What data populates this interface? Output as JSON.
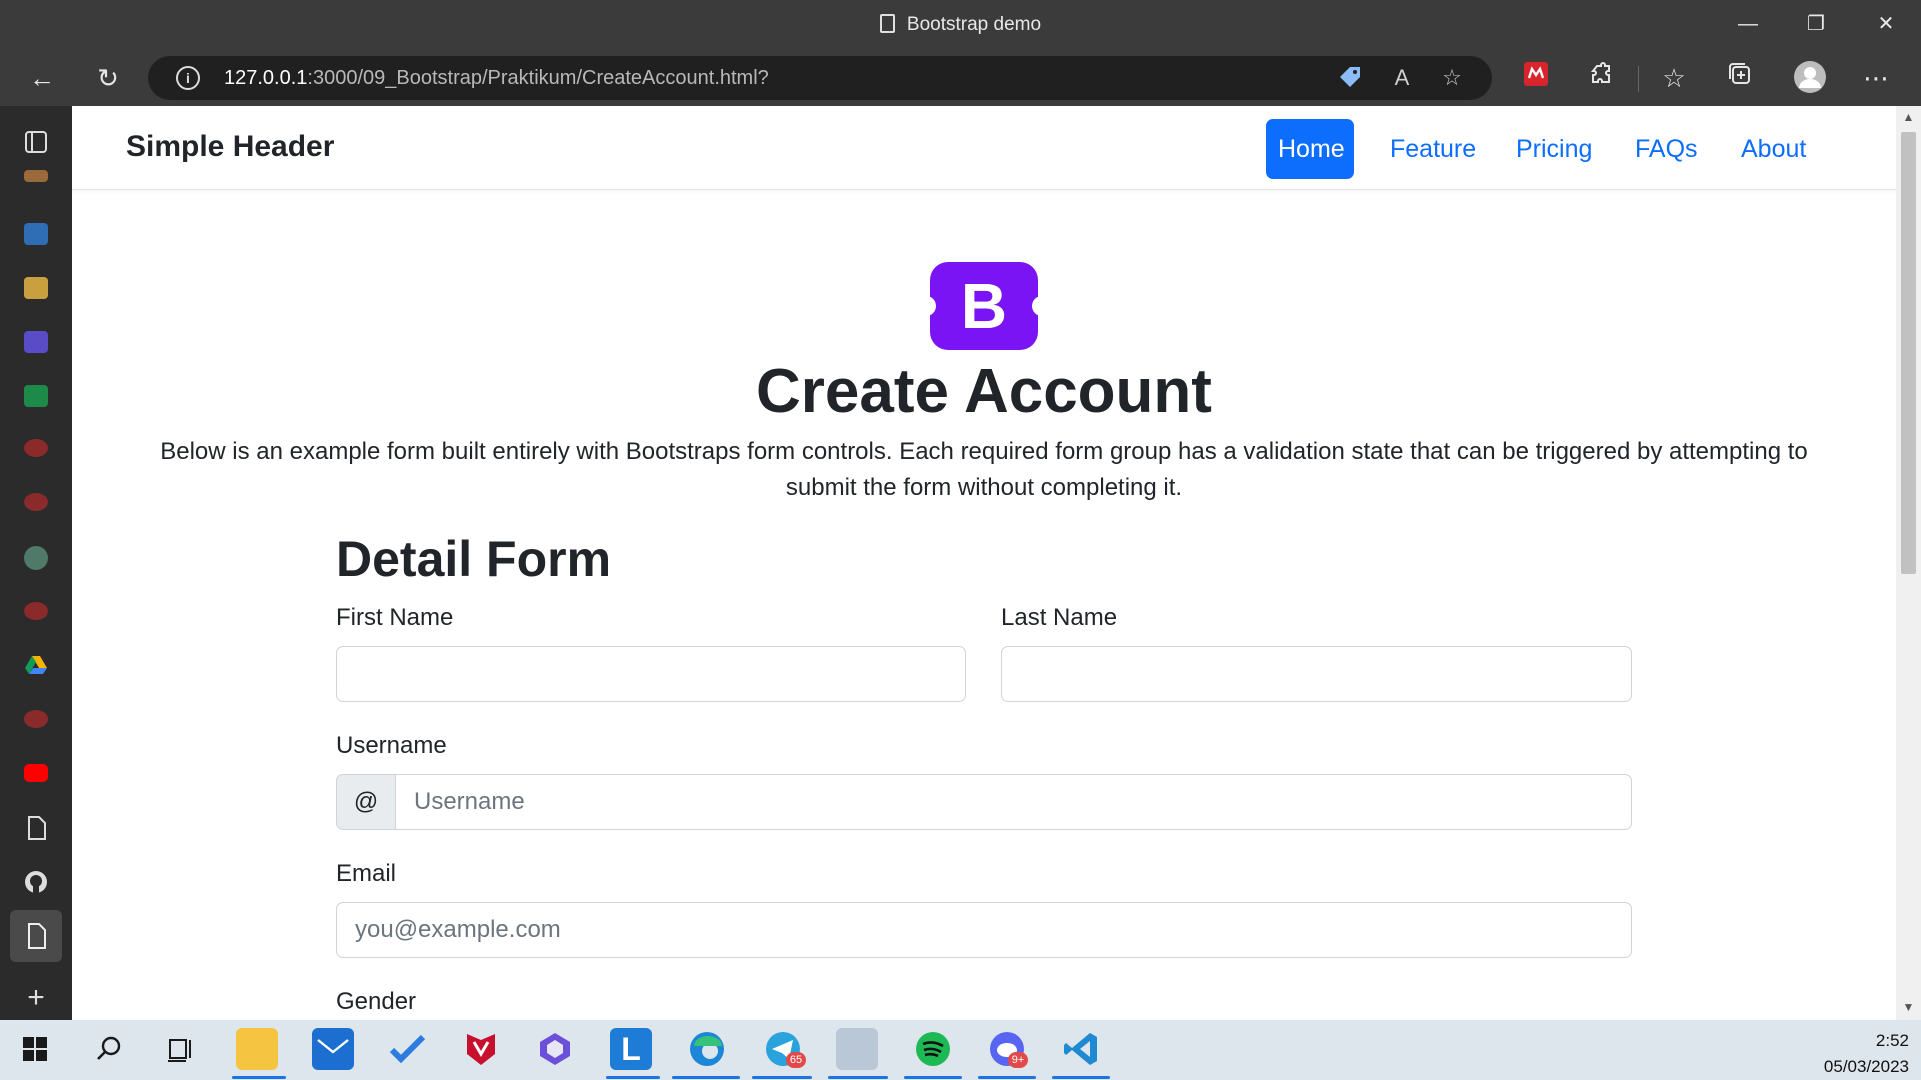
{
  "window": {
    "title": "Bootstrap demo",
    "minimize": "—",
    "restore": "❐",
    "close": "✕"
  },
  "toolbar": {
    "url_host": "127.0.0.1",
    "url_path": ":3000/09_Bootstrap/Praktikum/CreateAccount.html?",
    "back": "←",
    "reload": "↻",
    "info": "i",
    "more": "⋯"
  },
  "navbar": {
    "brand": "Simple Header",
    "links": [
      "Home",
      "Feature",
      "Pricing",
      "FAQs",
      "About"
    ],
    "active_index": 0
  },
  "hero": {
    "logo_letter": "B",
    "title": "Create Account",
    "lead": "Below is an example form built entirely with Bootstraps form controls. Each required form group has a validation state that can be triggered by attempting to submit the form without completing it."
  },
  "form": {
    "title": "Detail Form",
    "first_name_label": "First Name",
    "first_name_value": "",
    "last_name_label": "Last Name",
    "last_name_value": "",
    "username_label": "Username",
    "username_addon": "@",
    "username_placeholder": "Username",
    "email_label": "Email",
    "email_placeholder": "you@example.com",
    "gender_label": "Gender"
  },
  "taskbar": {
    "time": "2:52",
    "date": "05/03/2023",
    "badges": {
      "telegram": "65",
      "discord": "9+"
    }
  },
  "colors": {
    "primary": "#0d6efd",
    "bootstrap_purple": "#7a14f5",
    "chrome_dark": "#3b3b3b"
  }
}
